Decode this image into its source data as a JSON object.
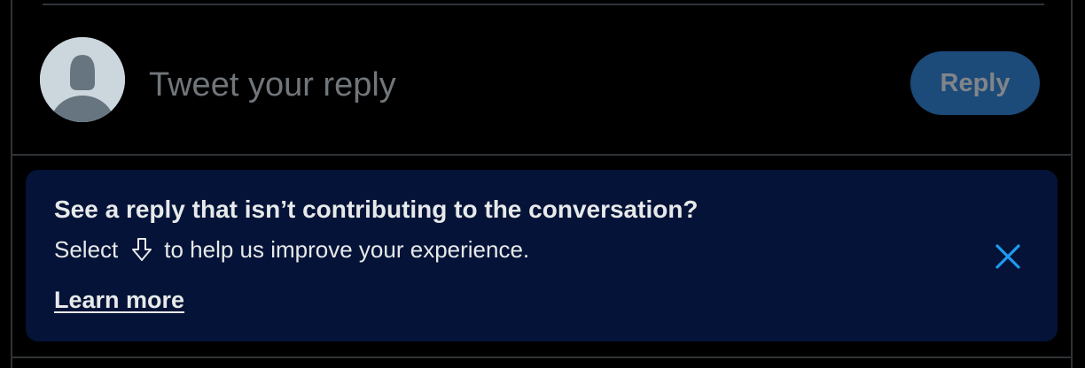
{
  "compose": {
    "placeholder": "Tweet your reply",
    "value": "",
    "reply_label": "Reply",
    "avatar_icon": "default-user-avatar"
  },
  "banner": {
    "title": "See a reply that isn’t contributing to the conversation?",
    "body_prefix": "Select",
    "body_icon": "arrow-down-icon",
    "body_suffix": "to help us improve your experience.",
    "link_label": "Learn more",
    "close_icon": "close-icon"
  },
  "colors": {
    "background": "#000000",
    "divider": "#2f3336",
    "reply_button_bg": "#1c4a79",
    "reply_button_text": "#808589",
    "banner_bg": "#041337",
    "close_icon": "#1d9bf0",
    "placeholder": "#71767b",
    "text": "#e7e9ea"
  }
}
